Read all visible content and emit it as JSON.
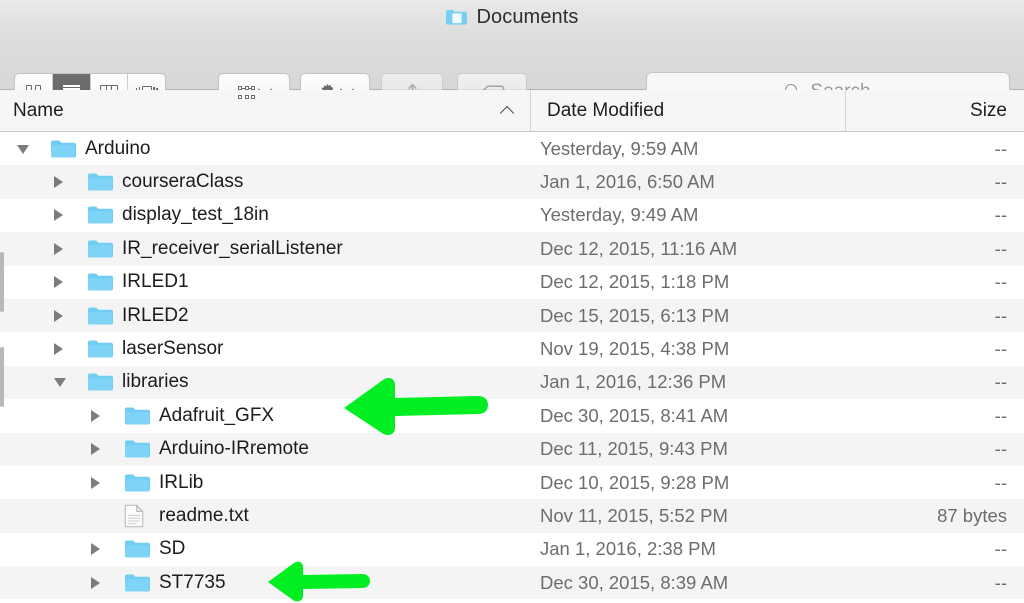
{
  "window": {
    "title": "Documents",
    "title_icon": "folder-icon"
  },
  "toolbar": {
    "view_modes": [
      {
        "name": "icon-view",
        "icon": "grid-icon",
        "active": false
      },
      {
        "name": "list-view",
        "icon": "list-icon",
        "active": true
      },
      {
        "name": "column-view",
        "icon": "columns-icon",
        "active": false
      },
      {
        "name": "coverflow-view",
        "icon": "coverflow-icon",
        "active": false
      }
    ],
    "arrange_button": {
      "name": "arrange-by-button",
      "icon": "arrange-grid-icon"
    },
    "action_button": {
      "name": "action-button",
      "icon": "gear-icon"
    },
    "share_button": {
      "name": "share-button",
      "icon": "share-icon"
    },
    "tag_button": {
      "name": "tag-button",
      "icon": "tag-icon"
    }
  },
  "search": {
    "placeholder": "Search",
    "icon": "search-icon",
    "value": ""
  },
  "columns": {
    "name": "Name",
    "date_modified": "Date Modified",
    "size": "Size",
    "sort_column": "Name",
    "sort_direction": "ascending"
  },
  "files": [
    {
      "name": "Arduino",
      "date": "Yesterday, 9:59 AM",
      "size": "--",
      "level": 0,
      "type": "folder",
      "expanded": true,
      "has_children": true
    },
    {
      "name": "courseraClass",
      "date": "Jan 1, 2016, 6:50 AM",
      "size": "--",
      "level": 1,
      "type": "folder",
      "expanded": false,
      "has_children": true
    },
    {
      "name": "display_test_18in",
      "date": "Yesterday, 9:49 AM",
      "size": "--",
      "level": 1,
      "type": "folder",
      "expanded": false,
      "has_children": true
    },
    {
      "name": "IR_receiver_serialListener",
      "date": "Dec 12, 2015, 11:16 AM",
      "size": "--",
      "level": 1,
      "type": "folder",
      "expanded": false,
      "has_children": true
    },
    {
      "name": "IRLED1",
      "date": "Dec 12, 2015, 1:18 PM",
      "size": "--",
      "level": 1,
      "type": "folder",
      "expanded": false,
      "has_children": true
    },
    {
      "name": "IRLED2",
      "date": "Dec 15, 2015, 6:13 PM",
      "size": "--",
      "level": 1,
      "type": "folder",
      "expanded": false,
      "has_children": true
    },
    {
      "name": "laserSensor",
      "date": "Nov 19, 2015, 4:38 PM",
      "size": "--",
      "level": 1,
      "type": "folder",
      "expanded": false,
      "has_children": true
    },
    {
      "name": "libraries",
      "date": "Jan 1, 2016, 12:36 PM",
      "size": "--",
      "level": 1,
      "type": "folder",
      "expanded": true,
      "has_children": true
    },
    {
      "name": "Adafruit_GFX",
      "date": "Dec 30, 2015, 8:41 AM",
      "size": "--",
      "level": 2,
      "type": "folder",
      "expanded": false,
      "has_children": true
    },
    {
      "name": "Arduino-IRremote",
      "date": "Dec 11, 2015, 9:43 PM",
      "size": "--",
      "level": 2,
      "type": "folder",
      "expanded": false,
      "has_children": true
    },
    {
      "name": "IRLib",
      "date": "Dec 10, 2015, 9:28 PM",
      "size": "--",
      "level": 2,
      "type": "folder",
      "expanded": false,
      "has_children": true
    },
    {
      "name": "readme.txt",
      "date": "Nov 11, 2015, 5:52 PM",
      "size": "87 bytes",
      "level": 2,
      "type": "file",
      "expanded": false,
      "has_children": false
    },
    {
      "name": "SD",
      "date": "Jan 1, 2016, 2:38 PM",
      "size": "--",
      "level": 2,
      "type": "folder",
      "expanded": false,
      "has_children": true
    },
    {
      "name": "ST7735",
      "date": "Dec 30, 2015, 8:39 AM",
      "size": "--",
      "level": 2,
      "type": "folder",
      "expanded": false,
      "has_children": true
    }
  ],
  "annotations": [
    {
      "name": "green-arrow-adafruit",
      "shape": "arrow-left",
      "color": "#00EE22",
      "points_to": "Adafruit_GFX"
    },
    {
      "name": "green-arrow-st7735",
      "shape": "arrow-left",
      "color": "#00EE22",
      "points_to": "ST7735"
    }
  ],
  "colors": {
    "folder_blue": "#6fcdf4",
    "folder_blue_dark": "#4bb8e8",
    "annotation_green": "#00EE22",
    "row_alt": "#f4f4f4",
    "header_bg": "#f6f6f6"
  }
}
